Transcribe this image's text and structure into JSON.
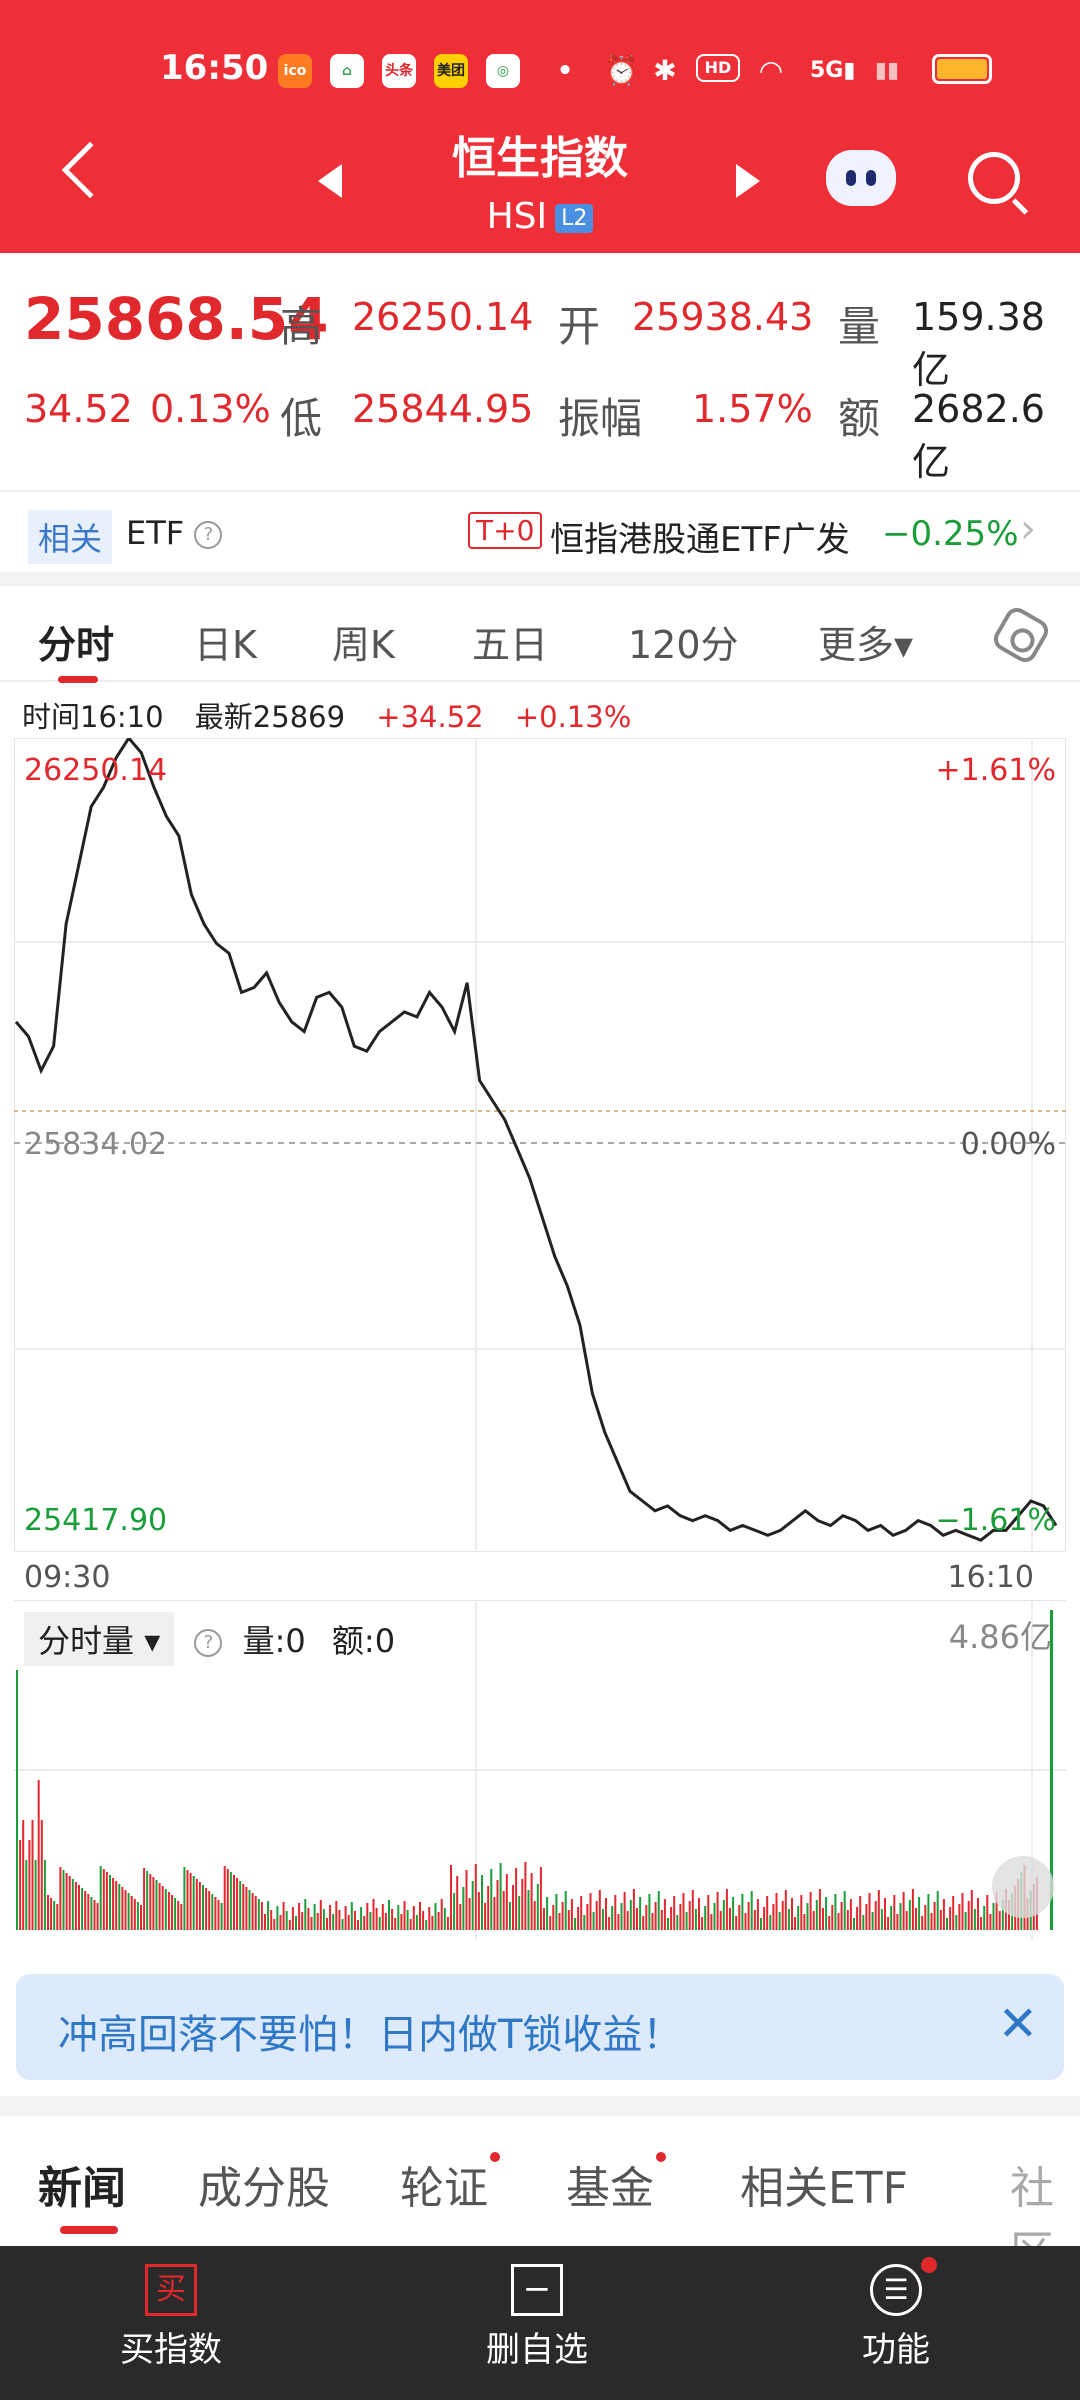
{
  "status": {
    "time": "16:50",
    "icons": [
      {
        "name": "app-icon-1",
        "label": "ico",
        "color": "#ff7b22"
      },
      {
        "name": "app-icon-2",
        "label": "⌂",
        "color": "#3aa15a"
      },
      {
        "name": "toutiao-icon",
        "label": "头条",
        "color": "#e0282d"
      },
      {
        "name": "meituan-icon",
        "label": "美团",
        "color": "#ffd000"
      },
      {
        "name": "bank-icon",
        "label": "◎",
        "color": "#1b9e3a"
      }
    ],
    "battery_color": "#ffb52e"
  },
  "header": {
    "title": "恒生指数",
    "code": "HSI",
    "level": "L2",
    "bg": "#ef2f38"
  },
  "quote": {
    "last": "25868.54",
    "change": "34.52",
    "change_pct": "0.13%",
    "high_label": "高",
    "high": "26250.14",
    "open_label": "开",
    "open": "25938.43",
    "vol_label": "量",
    "vol": "159.38亿",
    "low_label": "低",
    "low": "25844.95",
    "amp_label": "振幅",
    "amp": "1.57%",
    "amt_label": "额",
    "amt": "2682.6亿"
  },
  "etf": {
    "tag": "相关",
    "label": "ETF",
    "t0": "T+0",
    "name": "恒指港股通ETF广发",
    "pct": "−0.25%"
  },
  "tabs": [
    "分时",
    "日K",
    "周K",
    "五日",
    "120分",
    "更多▾"
  ],
  "info": {
    "time": "时间16:10",
    "latest": "最新25869",
    "chg": "+34.52",
    "pct": "+0.13%"
  },
  "chart_labels": {
    "top_price": "26250.14",
    "top_pct": "+1.61%",
    "mid_price": "25834.02",
    "mid_pct": "0.00%",
    "bot_price": "25417.90",
    "bot_pct": "−1.61%",
    "start": "09:30",
    "end": "16:10"
  },
  "chart_data": {
    "type": "line",
    "ylim": [
      25417.9,
      26250.14
    ],
    "baseline": 25834.02,
    "x_start": "09:30",
    "x_end": "16:10",
    "values": [
      25960,
      25945,
      25910,
      25935,
      26060,
      26120,
      26180,
      26200,
      26230,
      26250,
      26235,
      26200,
      26170,
      26150,
      26090,
      26060,
      26040,
      26030,
      25990,
      25995,
      26010,
      25980,
      25960,
      25950,
      25985,
      25990,
      25975,
      25935,
      25930,
      25950,
      25960,
      25970,
      25965,
      25990,
      25975,
      25950,
      26000,
      25900,
      25880,
      25860,
      25830,
      25800,
      25760,
      25720,
      25690,
      25650,
      25580,
      25540,
      25510,
      25480,
      25470,
      25460,
      25465,
      25455,
      25450,
      25455,
      25450,
      25440,
      25445,
      25440,
      25435,
      25440,
      25450,
      25460,
      25450,
      25445,
      25455,
      25450,
      25440,
      25445,
      25435,
      25440,
      25450,
      25445,
      25435,
      25440,
      25435,
      25430,
      25440,
      25440,
      25455,
      25470,
      25465,
      25445
    ]
  },
  "volume": {
    "label": "分时量",
    "vol": "量:0",
    "amt": "额:0",
    "max": "4.86亿"
  },
  "banner": {
    "text": "冲高回落不要怕！日内做T锁收益！"
  },
  "news_tabs": [
    "新闻",
    "成分股",
    "轮证",
    "基金",
    "相关ETF",
    "社区"
  ],
  "bottom": [
    {
      "label": "买指数",
      "icon": "买"
    },
    {
      "label": "删自选",
      "icon": "−"
    },
    {
      "label": "功能",
      "icon": "☰"
    }
  ]
}
